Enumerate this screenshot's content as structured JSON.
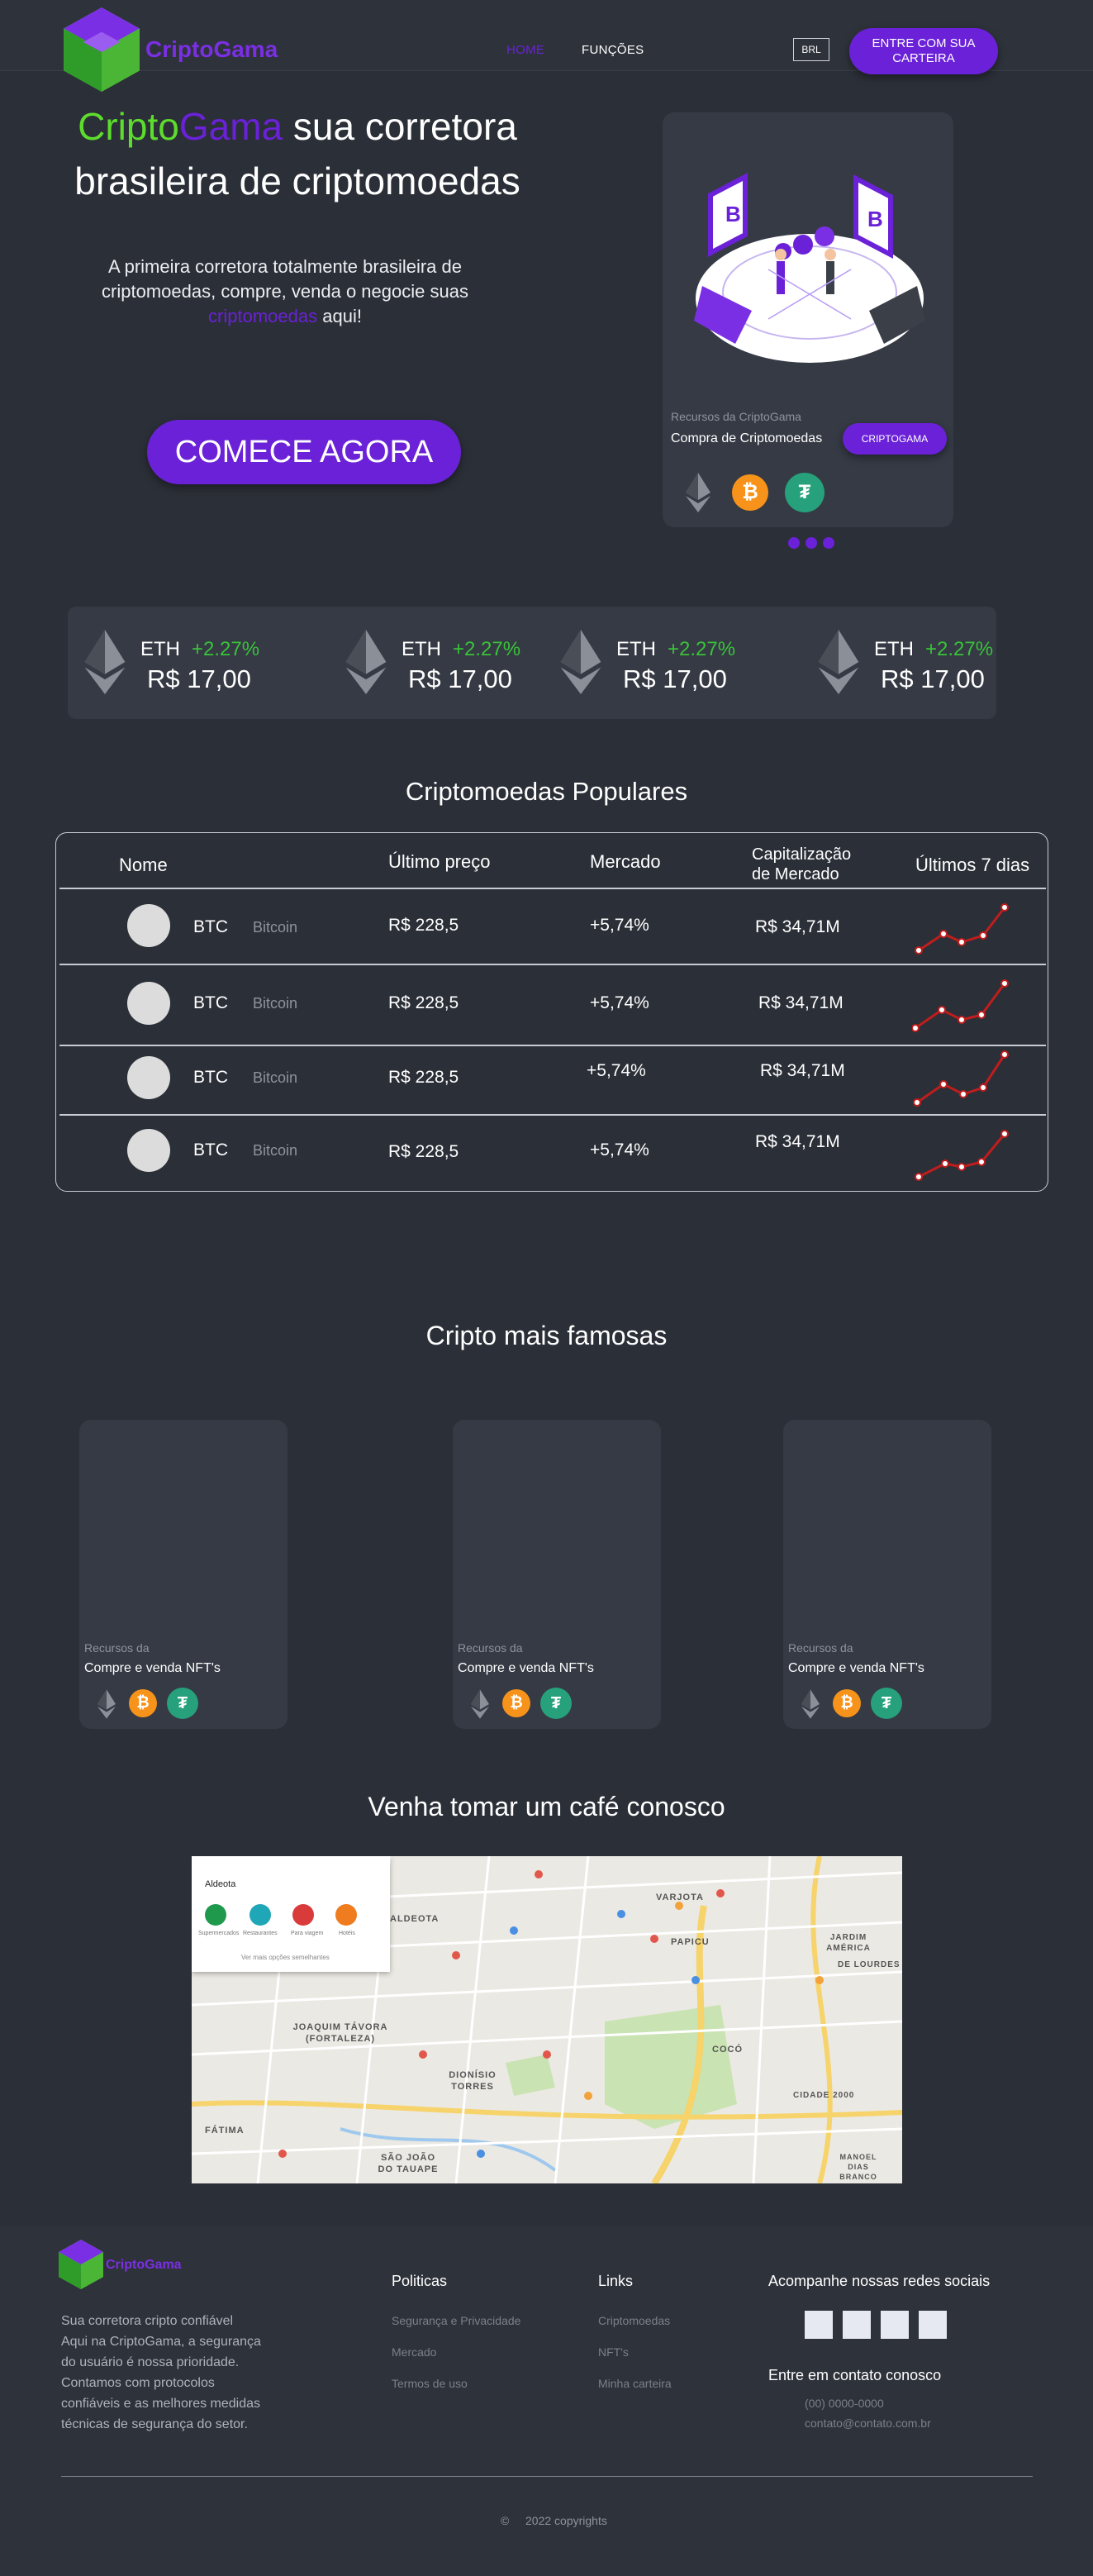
{
  "brand": {
    "name_part1": "Cripto",
    "name_part2": "Gama"
  },
  "nav": {
    "home": "HOME",
    "features": "FUNÇÕES",
    "currency": "BRL",
    "wallet_cta_line1": "ENTRE COM SUA",
    "wallet_cta_line2": "CARTEIRA"
  },
  "hero": {
    "title_cripto": "Cripto",
    "title_gama": "Gama",
    "title_line1_rest": " sua corretora",
    "title_line2": "brasileira de criptomoedas",
    "subtitle_line1": "A primeira corretora totalmente brasileira de",
    "subtitle_line2": "criptomoedas,  compre, venda o negocie suas",
    "subtitle_highlight": "criptomoedas",
    "subtitle_end": " aqui!",
    "cta": "COMECE AGORA"
  },
  "feature_card": {
    "small": "Recursos da CriptoGama",
    "title": "Compra de Criptomoedas",
    "button": "CRIPTOGAMA"
  },
  "ticker": [
    {
      "symbol": "ETH",
      "change": "+2.27%",
      "price": "R$ 17,00"
    },
    {
      "symbol": "ETH",
      "change": "+2.27%",
      "price": "R$ 17,00"
    },
    {
      "symbol": "ETH",
      "change": "+2.27%",
      "price": "R$ 17,00"
    },
    {
      "symbol": "ETH",
      "change": "+2.27%",
      "price": "R$ 17,00"
    }
  ],
  "popular": {
    "title": "Criptomoedas Populares",
    "headers": {
      "name": "Nome",
      "last_price": "Último preço",
      "market": "Mercado",
      "cap_line1": "Capitalização",
      "cap_line2": "de Mercado",
      "last7": "Últimos 7 dias"
    },
    "rows": [
      {
        "symbol": "BTC",
        "name": "Bitcoin",
        "price": "R$ 228,5",
        "market": "+5,74%",
        "cap": "R$ 34,71M"
      },
      {
        "symbol": "BTC",
        "name": "Bitcoin",
        "price": "R$ 228,5",
        "market": "+5,74%",
        "cap": "R$ 34,71M"
      },
      {
        "symbol": "BTC",
        "name": "Bitcoin",
        "price": "R$ 228,5",
        "market": "+5,74%",
        "cap": "R$ 34,71M"
      },
      {
        "symbol": "BTC",
        "name": "Bitcoin",
        "price": "R$ 228,5",
        "market": "+5,74%",
        "cap": "R$ 34,71M"
      }
    ]
  },
  "famous": {
    "title": "Cripto mais famosas",
    "cards": [
      {
        "small": "Recursos da",
        "title": "Compre e venda NFT's"
      },
      {
        "small": "Recursos da",
        "title": "Compre e venda NFT's"
      },
      {
        "small": "Recursos da",
        "title": "Compre e venda NFT's"
      }
    ]
  },
  "cafe": {
    "title": "Venha tomar um café conosco",
    "map_labels": {
      "place": "Aldeota",
      "cat1": "Supermercados",
      "cat2": "Restaurantes",
      "cat3": "Para viagem",
      "cat4": "Hotéis",
      "more": "Ver mais opções semelhantes",
      "n1": "ALDEOTA",
      "n2": "VARJOTA",
      "n3": "PAPICU",
      "n4": "JOAQUIM TÁVORA (FORTALEZA)",
      "n5": "DIONÍSIO TORRES",
      "n6": "COCÓ",
      "n7": "CIDADE 2000",
      "n8": "FÁTIMA",
      "n9": "SÃO JOÃO DO TAUAPE",
      "n10": "JARDIM AMÉRICA",
      "n11": "DE LOURDES",
      "n12": "MANOEL DIAS BRANCO"
    }
  },
  "footer": {
    "about": [
      "Sua corretora cripto confiável",
      "Aqui na CriptoGama, a segurança",
      "do usuário é nossa prioridade.",
      "Contamos com protocolos",
      "confiáveis e as melhores medidas",
      "técnicas de segurança do setor."
    ],
    "policies": {
      "title": "Politicas",
      "links": [
        "Segurança e Privacidade",
        "Mercado",
        "Termos de uso"
      ]
    },
    "links": {
      "title": "Links",
      "links": [
        "Criptomoedas",
        "NFT's",
        "Minha carteira"
      ]
    },
    "social": {
      "title": "Acompanhe nossas redes sociais",
      "contact_title": "Entre em contato conosco",
      "phone": "(00) 0000-0000",
      "email": "contato@contato.com.br"
    },
    "copyright_symbol": "©",
    "copyright": "2022 copyrights"
  },
  "colors": {
    "accent": "#6a21d8",
    "green": "#5ddc2d",
    "positive": "#3ac23a",
    "background": "#2b2f37"
  }
}
